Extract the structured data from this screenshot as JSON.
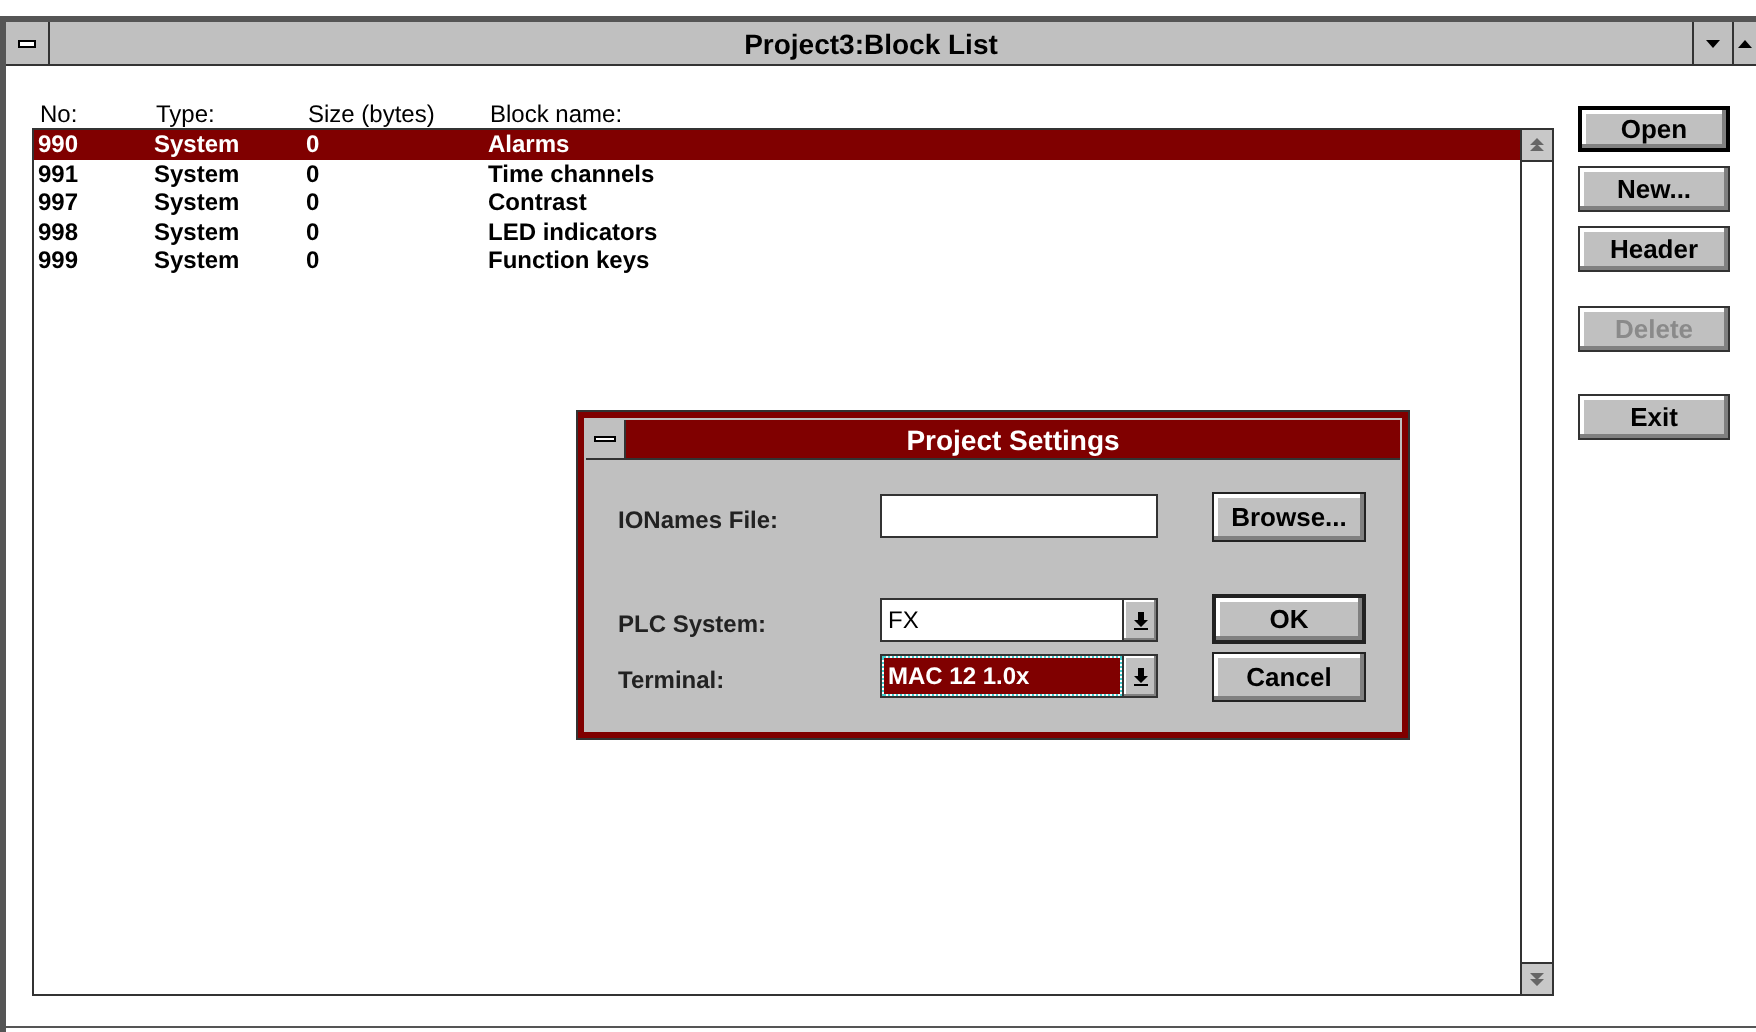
{
  "window": {
    "title": "Project3:Block List"
  },
  "table": {
    "columns": [
      "No:",
      "Type:",
      "Size (bytes)",
      "Block name:"
    ],
    "rows": [
      {
        "cells": [
          "990",
          "System",
          "0",
          "Alarms"
        ],
        "selected": true
      },
      {
        "cells": [
          "991",
          "System",
          "0",
          "Time channels"
        ],
        "selected": false
      },
      {
        "cells": [
          "997",
          "System",
          "0",
          "Contrast"
        ],
        "selected": false
      },
      {
        "cells": [
          "998",
          "System",
          "0",
          "LED indicators"
        ],
        "selected": false
      },
      {
        "cells": [
          "999",
          "System",
          "0",
          "Function keys"
        ],
        "selected": false
      }
    ]
  },
  "buttons": [
    {
      "label": "Open",
      "default": true,
      "disabled": false
    },
    {
      "label": "New...",
      "default": false,
      "disabled": false
    },
    {
      "label": "Header",
      "default": false,
      "disabled": false
    },
    {
      "label": "Delete",
      "default": false,
      "disabled": true
    },
    {
      "label": "Exit",
      "default": false,
      "disabled": false
    }
  ],
  "dialog": {
    "title": "Project Settings",
    "ionames": {
      "label": "IONames File:",
      "button": "Browse..."
    },
    "plc": {
      "label": "PLC System:",
      "value": "FX",
      "focused": false
    },
    "terminal": {
      "label": "Terminal:",
      "value": "MAC 12 1.0x",
      "focused": true
    },
    "buttons": [
      {
        "label": "OK",
        "default": true
      },
      {
        "label": "Cancel",
        "default": false
      }
    ]
  }
}
